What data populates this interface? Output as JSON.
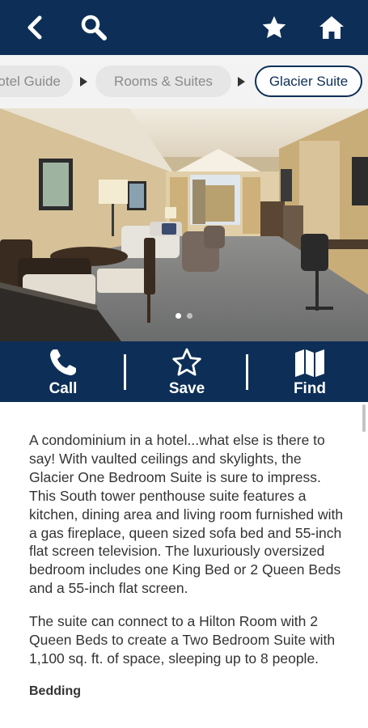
{
  "colors": {
    "brand": "#0d2f57",
    "breadcrumb_bg": "#f3f3f3",
    "chip_inactive": "#e6e6e6"
  },
  "toolbar": {
    "back_icon": "chevron-left-icon",
    "search_icon": "search-icon",
    "favorite_icon": "star-icon",
    "home_icon": "home-icon"
  },
  "breadcrumb": {
    "items": [
      "Hotel Guide",
      "Rooms & Suites",
      "Glacier Suite"
    ],
    "active_index": 2
  },
  "gallery": {
    "image": "hotel suite living room with dining table, sofa, desk and windows",
    "slide_count": 2,
    "current_slide": 1
  },
  "actions": [
    {
      "label": "Call",
      "icon": "phone-icon"
    },
    {
      "label": "Save",
      "icon": "star-outline-icon"
    },
    {
      "label": "Find",
      "icon": "map-icon"
    }
  ],
  "description": {
    "paragraphs": [
      "A condominium in a hotel...what else is there to say! With vaulted ceilings and skylights, the Glacier One Bedroom Suite is sure to impress. This South tower penthouse suite features a kitchen, dining area and living room furnished with a gas fireplace, queen sized sofa bed and 55-inch flat screen television. The luxuriously oversized bedroom includes one King Bed or 2 Queen Beds and a 55-inch flat screen.",
      "The suite can connect to a Hilton Room with 2 Queen Beds to create a Two Bedroom Suite with 1,100 sq. ft. of space, sleeping up to 8 people."
    ],
    "section_heading": "Bedding"
  }
}
